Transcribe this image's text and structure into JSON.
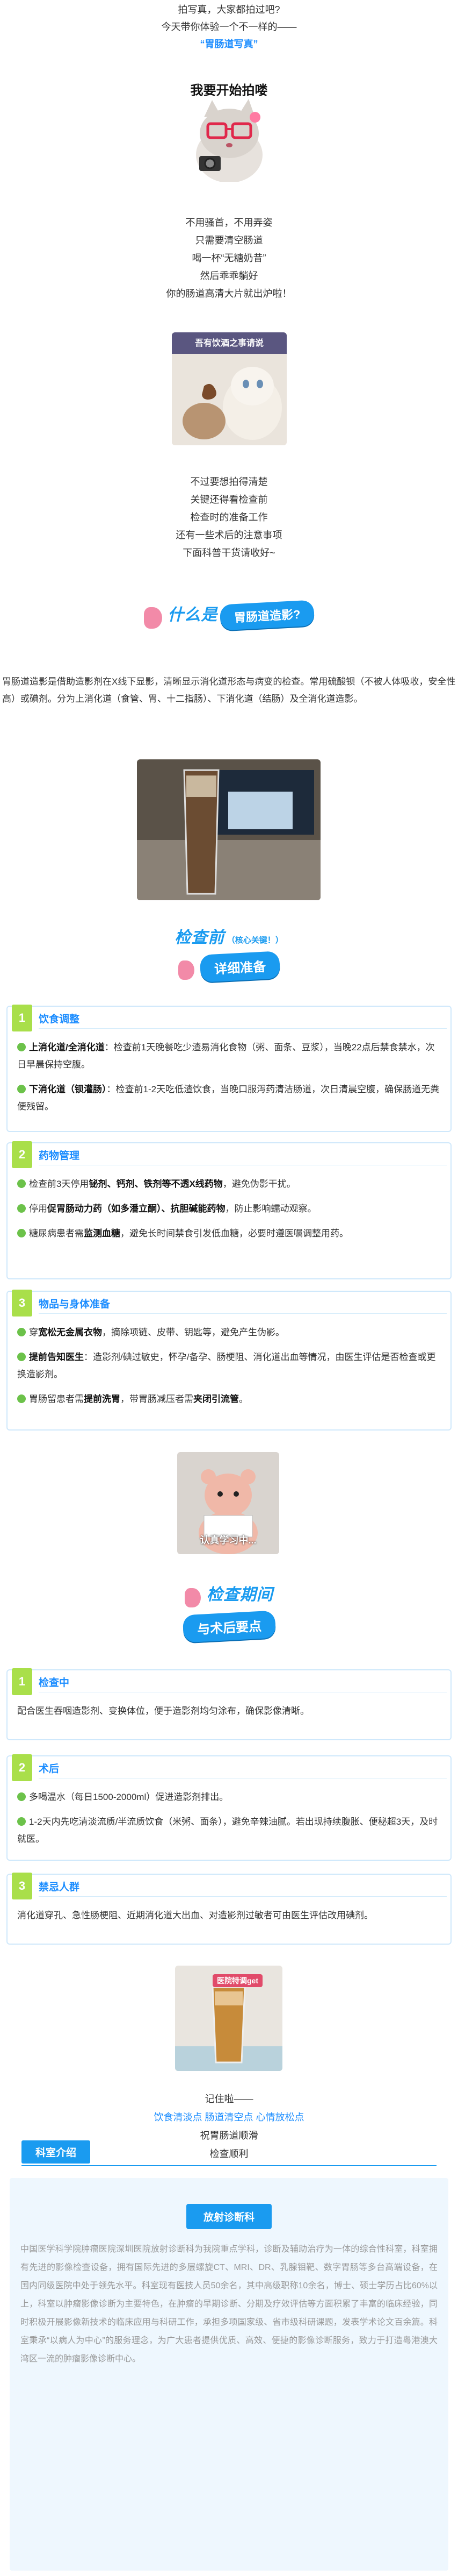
{
  "intro": {
    "line1": "拍写真，大家都拍过吧?",
    "line2": "今天带你体验一个不一样的——",
    "highlight": "“胃肠道写真”"
  },
  "start": {
    "heading": "我要开始拍喽"
  },
  "poem1": [
    "不用骚首，不用弄姿",
    "只需要清空肠道",
    "喝一杯“无糖奶昔”",
    "然后乖乖躺好",
    "你的肠道高清大片就出炉啦！"
  ],
  "meme1_caption": "吾有饮酒之事请说",
  "poem2": [
    "不过要想拍得清楚",
    "关键还得看检查前",
    "检查时的准备工作",
    "还有一些术后的注意事项",
    "下面科普干货请收好~"
  ],
  "what": {
    "prefix": "什么是",
    "pill": "胃肠道造影?"
  },
  "what_text": "胃肠道造影是借助造影剂在X线下显影，清晰显示消化道形态与病变的检查。常用硫酸钡（不被人体吸收，安全性高）或碘剂。分为上消化道（食管、胃、十二指肠）、下消化道（结肠）及全消化道造影。",
  "before": {
    "title": "检查前",
    "note": "（核心关键！）",
    "pill": "详细准备"
  },
  "cards": {
    "diet": {
      "num": "1",
      "title": "饮食调整",
      "p1_label": "上消化道/全消化道",
      "p1_text": "：检查前1天晚餐吃少渣易消化食物（粥、面条、豆浆），当晚22点后禁食禁水，次日早晨保持空腹。",
      "p2_label": "下消化道（钡灌肠）",
      "p2_text": "：检查前1-2天吃低渣饮食，当晚口服泻药清洁肠道，次日清晨空腹，确保肠道无粪便残留。"
    },
    "meds": {
      "num": "2",
      "title": "药物管理",
      "i1_a": "检查前3天停用",
      "i1_b": "铋剂、钙剂、铁剂等不透X线药物",
      "i1_c": "，避免伪影干扰。",
      "i2_a": "停用",
      "i2_b": "促胃肠动力药（如多潘立酮）、抗胆碱能药物",
      "i2_c": "，防止影响蠕动观察。",
      "i3_a": "糖尿病患者需",
      "i3_b": "监测血糖",
      "i3_c": "，避免长时间禁食引发低血糖，必要时遵医嘱调整用药。"
    },
    "items": {
      "num": "3",
      "title": "物品与身体准备",
      "i1_a": "穿",
      "i1_b": "宽松无金属衣物",
      "i1_c": "，摘除项链、皮带、钥匙等，避免产生伪影。",
      "i2_a": "提前告知医生",
      "i2_b": "：造影剂/碘过敏史，怀孕/备孕、肠梗阻、消化道出血等情况，由医生评估是否检查或更换造影剂。",
      "i3_a": "胃肠留患者需",
      "i3_b": "提前洗胃",
      "i3_c": "，带胃肠减压者需",
      "i3_d": "夹闭引流管",
      "i3_e": "。"
    },
    "during_check": {
      "num": "1",
      "title": "检查中",
      "text": "配合医生吞咽造影剂、变换体位，便于造影剂均匀涂布，确保影像清晰。"
    },
    "after": {
      "num": "2",
      "title": "术后",
      "t1": "多喝温水（每日1500-2000ml）促进造影剂排出。",
      "t2": "1-2天内先吃清淡流质/半流质饮食（米粥、面条），避免辛辣油腻。若出现持续腹胀、便秘超3天，及时就医。"
    },
    "forbid": {
      "num": "3",
      "title": "禁忌人群",
      "text": "消化道穿孔、急性肠梗阻、近期消化道大出血、对造影剂过敏者可由医生评估改用碘剂。"
    }
  },
  "meme2_caption": "认真学习中...",
  "during": {
    "title": "检查期间",
    "pill": "与术后要点"
  },
  "photo_badge": "医院特调get",
  "outro": {
    "line1": "记住啦——",
    "line2": "饮食清淡点 肠道清空点 心情放松点",
    "line3": "祝胃肠道顺滑",
    "line4": "检查顺利"
  },
  "dept": {
    "tag": "科室介绍",
    "pill": "放射诊断科",
    "text": "中国医学科学院肿瘤医院深圳医院放射诊断科为我院重点学科，诊断及辅助治疗为一体的综合性科室，科室拥有先进的影像检查设备，拥有国际先进的多层螺旋CT、MRI、DR、乳腺钼靶、数字胃肠等多台高端设备，在国内同级医院中处于领先水平。科室现有医技人员50余名，其中高级职称10余名，博士、硕士学历占比60%以上，科室以肿瘤影像诊断为主要特色，在肿瘤的早期诊断、分期及疗效评估等方面积累了丰富的临床经验，同时积极开展影像新技术的临床应用与科研工作，承担多项国家级、省市级科研课题，发表学术论文百余篇。科室秉承“以病人为中心”的服务理念，为广大患者提供优质、高效、便捷的影像诊断服务，致力于打造粤港澳大湾区一流的肿瘤影像诊断中心。"
  }
}
